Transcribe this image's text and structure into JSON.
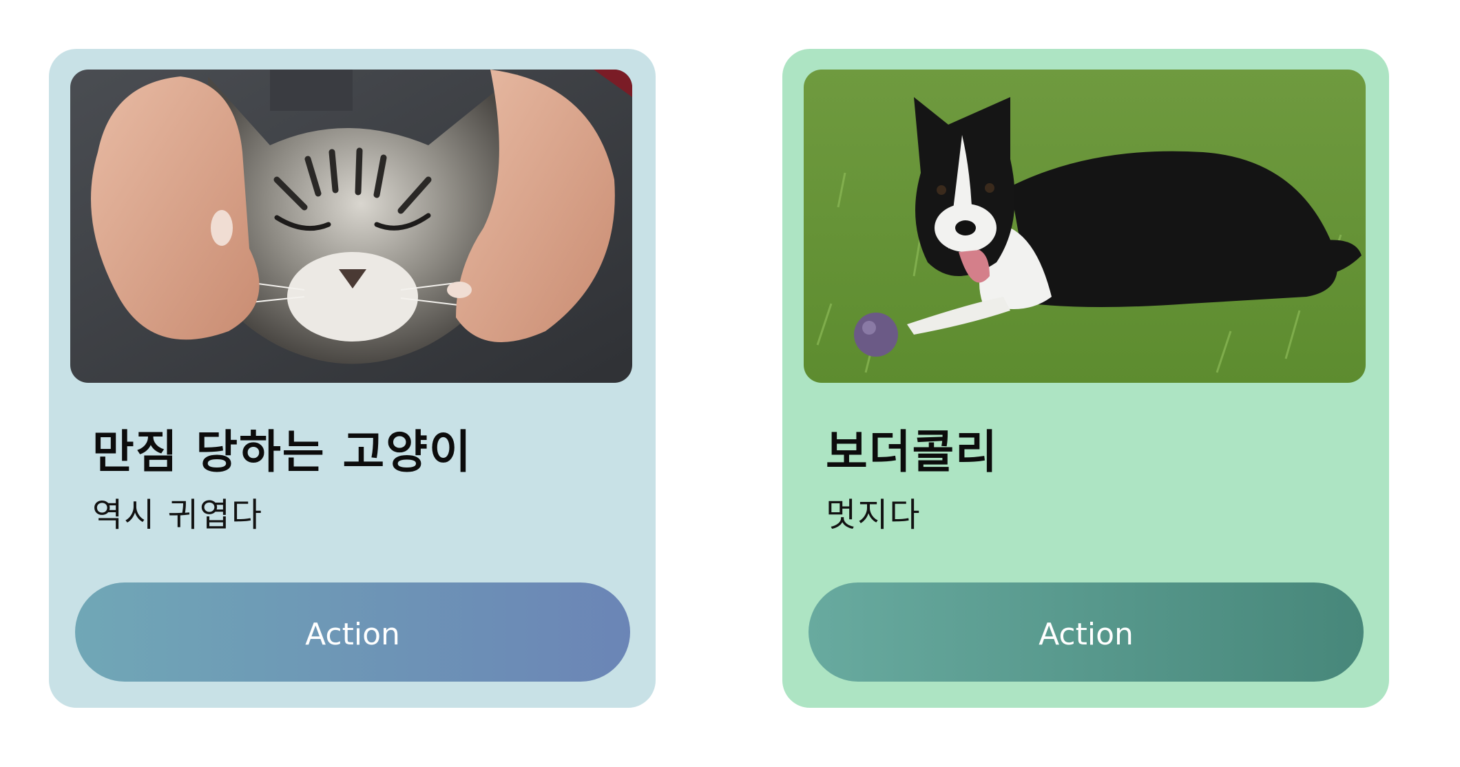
{
  "cards": [
    {
      "title": "만짐 당하는 고양이",
      "subtitle": "역시 귀엽다",
      "action_label": "Action",
      "image": "cat-being-petted",
      "background": "#c8e1e6"
    },
    {
      "title": "보더콜리",
      "subtitle": "멋지다",
      "action_label": "Action",
      "image": "border-collie-on-grass",
      "background": "#ade4c3"
    }
  ]
}
